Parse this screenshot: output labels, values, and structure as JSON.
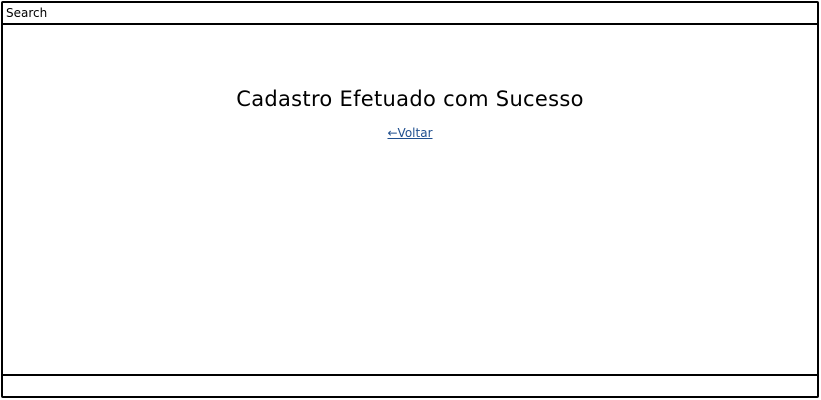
{
  "search": {
    "placeholder": "Search"
  },
  "main": {
    "title": "Cadastro Efetuado com Sucesso",
    "back_link": "←Voltar"
  },
  "colors": {
    "link": "#1f4f8f",
    "border": "#000000",
    "background": "#ffffff"
  }
}
